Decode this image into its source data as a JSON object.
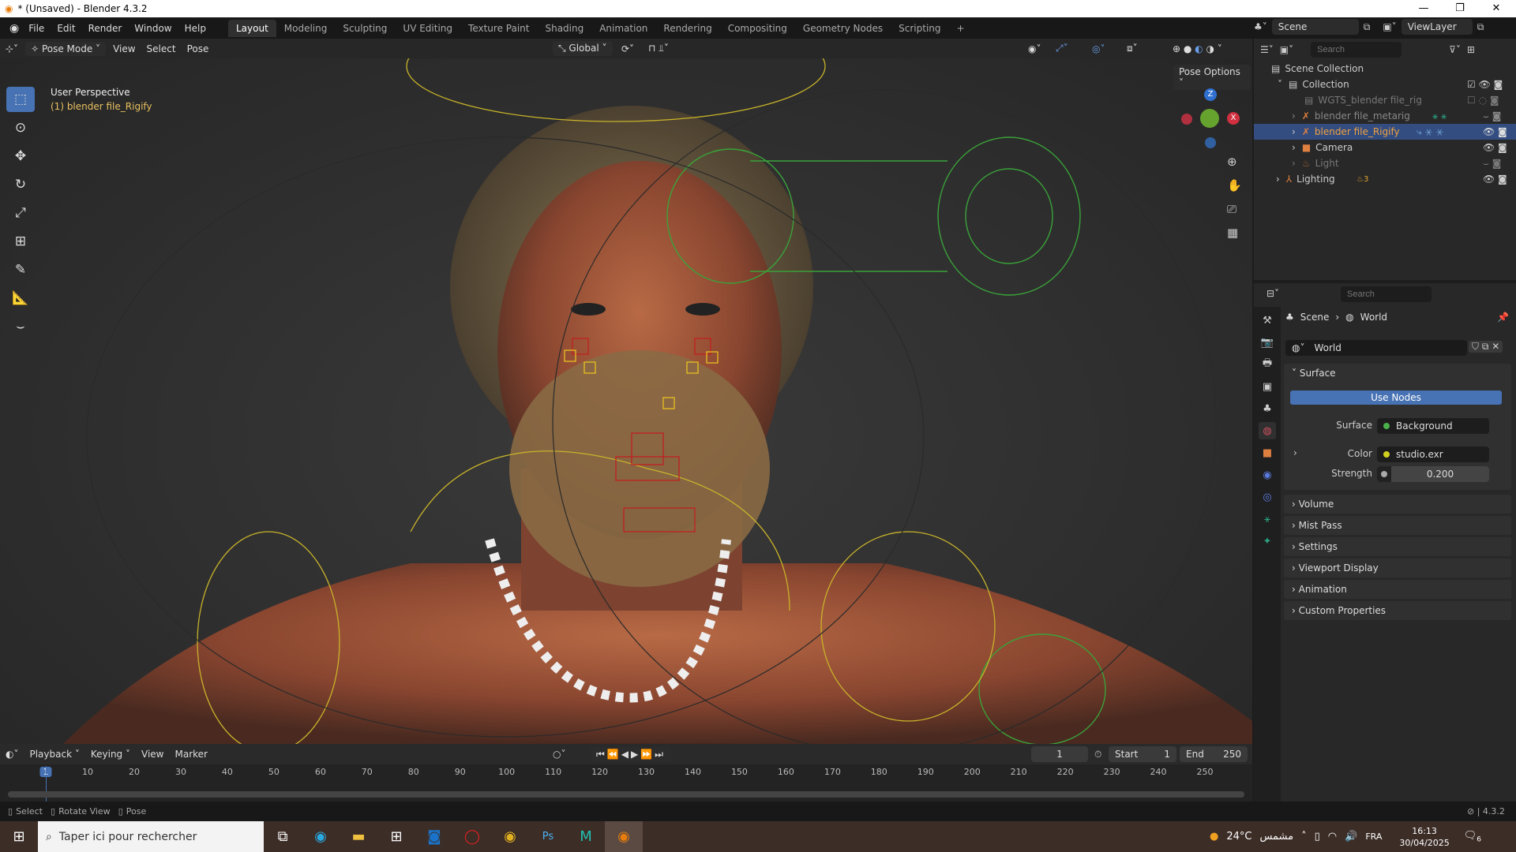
{
  "window": {
    "title": "* (Unsaved) - Blender 4.3.2"
  },
  "menu": {
    "items": [
      "File",
      "Edit",
      "Render",
      "Window",
      "Help"
    ],
    "workspaces": [
      "Layout",
      "Modeling",
      "Sculpting",
      "UV Editing",
      "Texture Paint",
      "Shading",
      "Animation",
      "Rendering",
      "Compositing",
      "Geometry Nodes",
      "Scripting"
    ],
    "add": "+"
  },
  "viewport_header": {
    "mode": "Pose Mode",
    "menus": [
      "View",
      "Select",
      "Pose"
    ],
    "orientation": "Global",
    "pose_options": "Pose Options"
  },
  "viewport": {
    "view_name": "User Perspective",
    "object_label": "(1) blender file_Rigify",
    "gizmo": {
      "z": "Z",
      "x": "X"
    }
  },
  "top_right": {
    "scene": "Scene",
    "view_layer": "ViewLayer"
  },
  "outliner": {
    "search_placeholder": "Search",
    "items": [
      {
        "label": "Scene Collection"
      },
      {
        "label": "Collection"
      },
      {
        "label": "WGTS_blender file_rig"
      },
      {
        "label": "blender file_metarig"
      },
      {
        "label": "blender file_Rigify"
      },
      {
        "label": "Camera"
      },
      {
        "label": "Light"
      },
      {
        "label": "Lighting",
        "badge": "3"
      }
    ]
  },
  "properties": {
    "search_placeholder": "Search",
    "breadcrumb": [
      "Scene",
      "World"
    ],
    "world_name": "World",
    "surface_panel": "Surface",
    "use_nodes": "Use Nodes",
    "surface_label": "Surface",
    "surface_value": "Background",
    "color_label": "Color",
    "color_value": "studio.exr",
    "strength_label": "Strength",
    "strength_value": "0.200",
    "panels": [
      "Volume",
      "Mist Pass",
      "Settings",
      "Viewport Display",
      "Animation",
      "Custom Properties"
    ]
  },
  "timeline": {
    "menus": [
      "Playback",
      "Keying",
      "View",
      "Marker"
    ],
    "current_frame": "1",
    "start_label": "Start",
    "start": "1",
    "end_label": "End",
    "end": "250",
    "ticks": [
      "1",
      "10",
      "20",
      "30",
      "40",
      "50",
      "60",
      "70",
      "80",
      "90",
      "100",
      "110",
      "120",
      "130",
      "140",
      "150",
      "160",
      "170",
      "180",
      "190",
      "200",
      "210",
      "220",
      "230",
      "240",
      "250"
    ]
  },
  "statusbar": {
    "items": [
      "Select",
      "Rotate View",
      "Pose"
    ],
    "version": "4.3.2"
  },
  "taskbar": {
    "search_placeholder": "Taper ici pour rechercher",
    "weather": "24°C",
    "weather_city": "مشمس",
    "lang": "FRA",
    "time": "16:13",
    "date": "30/04/2025",
    "notifications": "6"
  }
}
